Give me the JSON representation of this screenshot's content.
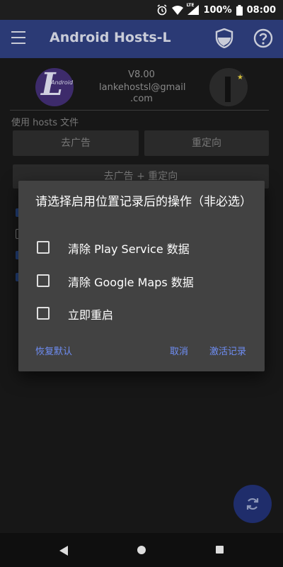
{
  "status_bar": {
    "lte": "LTE",
    "battery": "100%",
    "time": "08:00"
  },
  "app_bar": {
    "title": "Android Hosts-L"
  },
  "profile": {
    "version": "V8.00",
    "email_line1": "lankehostsl@gmail",
    "email_line2": ".com",
    "logo_text": "Android"
  },
  "main": {
    "section_label": "使用 hosts 文件",
    "btn_adblock": "去广告",
    "btn_redirect": "重定向",
    "btn_both": "去广告 + 重定向"
  },
  "dialog": {
    "title": "请选择启用位置记录后的操作（非必选）",
    "options": [
      {
        "label": "清除 Play Service 数据",
        "checked": false
      },
      {
        "label": "清除 Google Maps 数据",
        "checked": false
      },
      {
        "label": "立即重启",
        "checked": false
      }
    ],
    "btn_restore": "恢复默认",
    "btn_cancel": "取消",
    "btn_activate": "激活记录"
  },
  "colors": {
    "app_bar": "#2b3a75",
    "dialog_bg": "#424242",
    "accent": "#6f8ef5"
  }
}
